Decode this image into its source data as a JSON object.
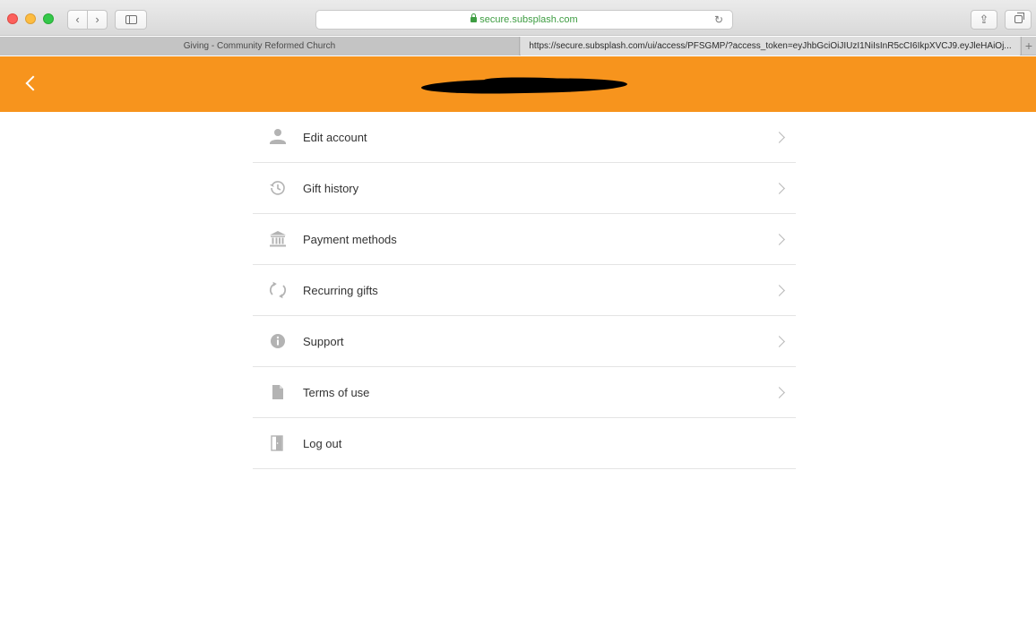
{
  "browser": {
    "address": "secure.subsplash.com",
    "tabs": [
      {
        "label": "Giving - Community Reformed Church"
      },
      {
        "label": "https://secure.subsplash.com/ui/access/PFSGMP/?access_token=eyJhbGciOiJIUzI1NiIsInR5cCI6IkpXVCJ9.eyJleHAiOj..."
      }
    ],
    "new_tab_symbol": "+"
  },
  "header": {
    "title": "",
    "back_icon": "chevron-left-icon",
    "background": "#f7941d"
  },
  "menu": {
    "items": [
      {
        "label": "Edit account",
        "icon": "person-icon",
        "chevron": true
      },
      {
        "label": "Gift history",
        "icon": "history-icon",
        "chevron": true
      },
      {
        "label": "Payment methods",
        "icon": "bank-icon",
        "chevron": true
      },
      {
        "label": "Recurring gifts",
        "icon": "recurring-icon",
        "chevron": true
      },
      {
        "label": "Support",
        "icon": "info-icon",
        "chevron": true
      },
      {
        "label": "Terms of use",
        "icon": "document-icon",
        "chevron": true
      },
      {
        "label": "Log out",
        "icon": "logout-door-icon",
        "chevron": false
      }
    ]
  },
  "colors": {
    "accent": "#f7941d",
    "icon_gray": "#b3b3b3",
    "divider": "#e4e4e4"
  }
}
